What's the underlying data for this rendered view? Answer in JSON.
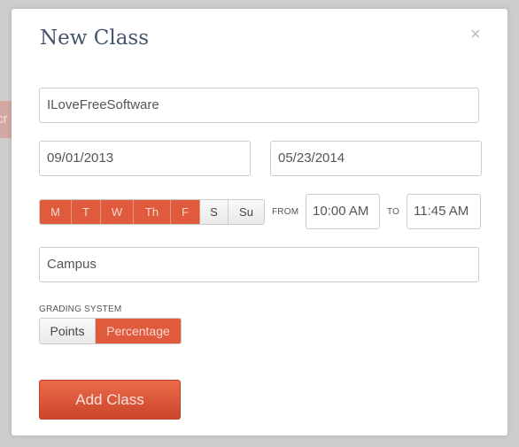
{
  "background": {
    "button_fragment": "cr"
  },
  "modal": {
    "title": "New Class",
    "close_icon": "close-icon",
    "class_name": "ILoveFreeSoftware",
    "start_date": "09/01/2013",
    "end_date": "05/23/2014",
    "days": [
      {
        "label": "M",
        "selected": true
      },
      {
        "label": "T",
        "selected": true
      },
      {
        "label": "W",
        "selected": true
      },
      {
        "label": "Th",
        "selected": true
      },
      {
        "label": "F",
        "selected": true
      },
      {
        "label": "S",
        "selected": false
      },
      {
        "label": "Su",
        "selected": false
      }
    ],
    "from_label": "FROM",
    "from_time": "10:00 AM",
    "to_label": "TO",
    "to_time": "11:45 AM",
    "location": "Campus",
    "grading_label": "GRADING SYSTEM",
    "grading_options": [
      {
        "label": "Points",
        "selected": false
      },
      {
        "label": "Percentage",
        "selected": true
      }
    ],
    "submit_label": "Add Class"
  },
  "colors": {
    "accent": "#e05a3d",
    "title": "#44546a"
  }
}
